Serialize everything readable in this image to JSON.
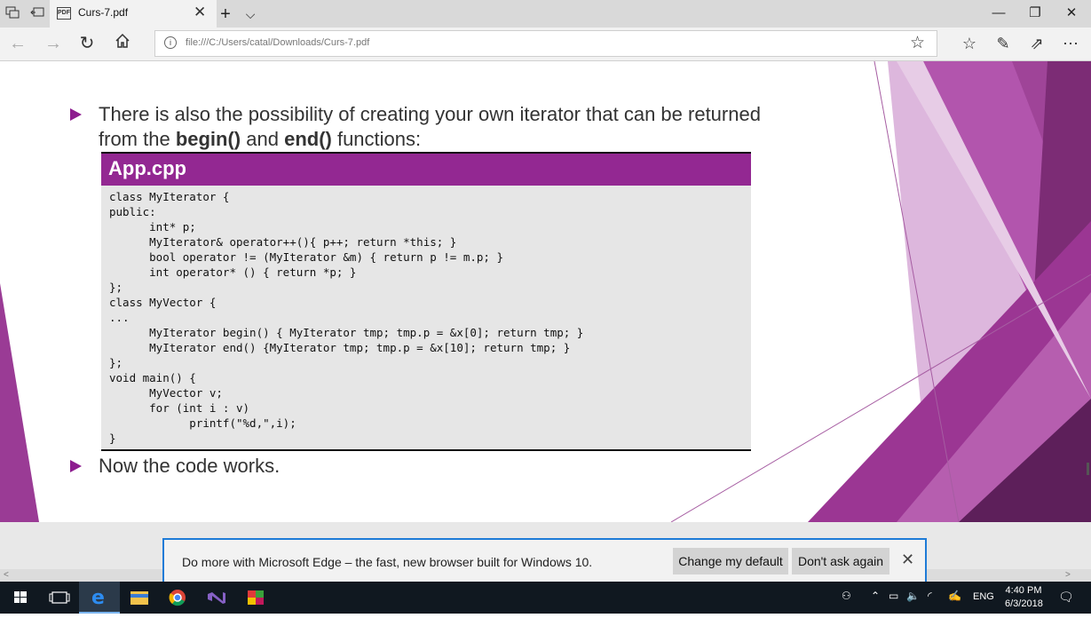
{
  "browser": {
    "tab_title": "Curs-7.pdf",
    "tab_close": "✕",
    "tab_new": "+",
    "tab_menu": "⌵",
    "address": "file:///C:/Users/catal/Downloads/Curs-7.pdf",
    "win_minimize": "—",
    "win_restore": "❐",
    "win_close": "✕"
  },
  "slide": {
    "bullet1_line1": "There is also the possibility of creating your own iterator that can be returned",
    "bullet1_line2_prefix": "from the ",
    "bullet1_begin": "begin()",
    "bullet1_and": " and ",
    "bullet1_end": "end()",
    "bullet1_suffix": " functions:",
    "code_title": "App.cpp",
    "code_lines": [
      "class MyIterator {",
      "public:",
      "      int* p;",
      "      MyIterator& operator++(){ p++; return *this; }",
      "      bool operator != (MyIterator &m) { return p != m.p; }",
      "      int operator* () { return *p; }",
      "};",
      "class MyVector {",
      "...",
      "      MyIterator begin() { MyIterator tmp; tmp.p = &x[0]; return tmp; }",
      "      MyIterator end() {MyIterator tmp; tmp.p = &x[10]; return tmp; }",
      "};",
      "void main() {",
      "      MyVector v;",
      "      for (int i : v)",
      "            printf(\"%d,\",i);",
      "}"
    ],
    "bullet2": "Now the code works."
  },
  "notification": {
    "message": "Do more with Microsoft Edge – the fast, new browser built for Windows 10.",
    "change_default": "Change my default",
    "dont_ask": "Don't ask again",
    "close": "✕"
  },
  "taskbar": {
    "language": "ENG",
    "time": "4:40 PM",
    "date": "6/3/2018"
  },
  "colors": {
    "accent_purple": "#932892",
    "bullet_purple": "#8d1d8f",
    "edge_blue": "#1e7bd7"
  }
}
